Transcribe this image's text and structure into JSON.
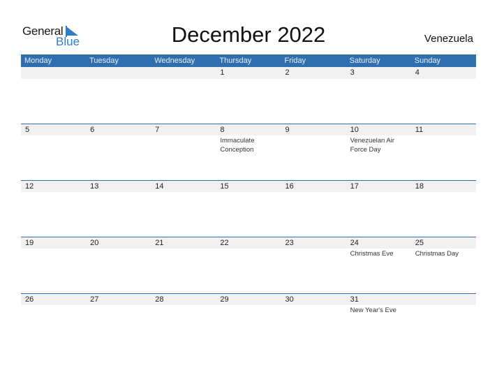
{
  "logo": {
    "general": "General",
    "blue": "Blue"
  },
  "title": "December 2022",
  "country": "Venezuela",
  "colors": {
    "header_bg": "#2f6fb0",
    "date_bar_bg": "#f1f1f1",
    "logo_blue": "#2a7fc9"
  },
  "weekdays": [
    "Monday",
    "Tuesday",
    "Wednesday",
    "Thursday",
    "Friday",
    "Saturday",
    "Sunday"
  ],
  "weeks": [
    [
      {
        "day": "",
        "event": ""
      },
      {
        "day": "",
        "event": ""
      },
      {
        "day": "",
        "event": ""
      },
      {
        "day": "1",
        "event": ""
      },
      {
        "day": "2",
        "event": ""
      },
      {
        "day": "3",
        "event": ""
      },
      {
        "day": "4",
        "event": ""
      }
    ],
    [
      {
        "day": "5",
        "event": ""
      },
      {
        "day": "6",
        "event": ""
      },
      {
        "day": "7",
        "event": ""
      },
      {
        "day": "8",
        "event": "Immaculate Conception"
      },
      {
        "day": "9",
        "event": ""
      },
      {
        "day": "10",
        "event": "Venezuelan Air Force Day"
      },
      {
        "day": "11",
        "event": ""
      }
    ],
    [
      {
        "day": "12",
        "event": ""
      },
      {
        "day": "13",
        "event": ""
      },
      {
        "day": "14",
        "event": ""
      },
      {
        "day": "15",
        "event": ""
      },
      {
        "day": "16",
        "event": ""
      },
      {
        "day": "17",
        "event": ""
      },
      {
        "day": "18",
        "event": ""
      }
    ],
    [
      {
        "day": "19",
        "event": ""
      },
      {
        "day": "20",
        "event": ""
      },
      {
        "day": "21",
        "event": ""
      },
      {
        "day": "22",
        "event": ""
      },
      {
        "day": "23",
        "event": ""
      },
      {
        "day": "24",
        "event": "Christmas Eve"
      },
      {
        "day": "25",
        "event": "Christmas Day"
      }
    ],
    [
      {
        "day": "26",
        "event": ""
      },
      {
        "day": "27",
        "event": ""
      },
      {
        "day": "28",
        "event": ""
      },
      {
        "day": "29",
        "event": ""
      },
      {
        "day": "30",
        "event": ""
      },
      {
        "day": "31",
        "event": "New Year's Eve"
      },
      {
        "day": "",
        "event": ""
      }
    ]
  ]
}
